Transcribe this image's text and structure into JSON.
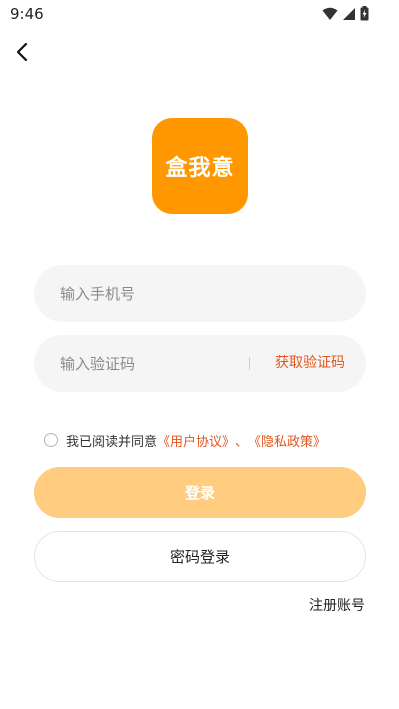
{
  "status_bar": {
    "time": "9:46"
  },
  "logo": {
    "text": "盒我意",
    "bg_color": "#FF9800"
  },
  "phone": {
    "placeholder": "输入手机号"
  },
  "code": {
    "placeholder": "输入验证码",
    "get_code_label": "获取验证码"
  },
  "agreement": {
    "prefix": "我已阅读并同意",
    "user_agreement": "《用户协议》",
    "separator": "、",
    "privacy_policy": "《隐私政策》"
  },
  "login_button": {
    "label": "登录"
  },
  "password_login_button": {
    "label": "密码登录"
  },
  "register_link": {
    "label": "注册账号"
  },
  "colors": {
    "accent": "#E2561E",
    "login_button_bg": "#FFCC80",
    "field_bg": "#F5F5F5"
  },
  "icons": {
    "back": "chevron-left-icon",
    "wifi": "wifi-icon",
    "signal": "cell-signal-icon",
    "battery": "battery-icon"
  }
}
